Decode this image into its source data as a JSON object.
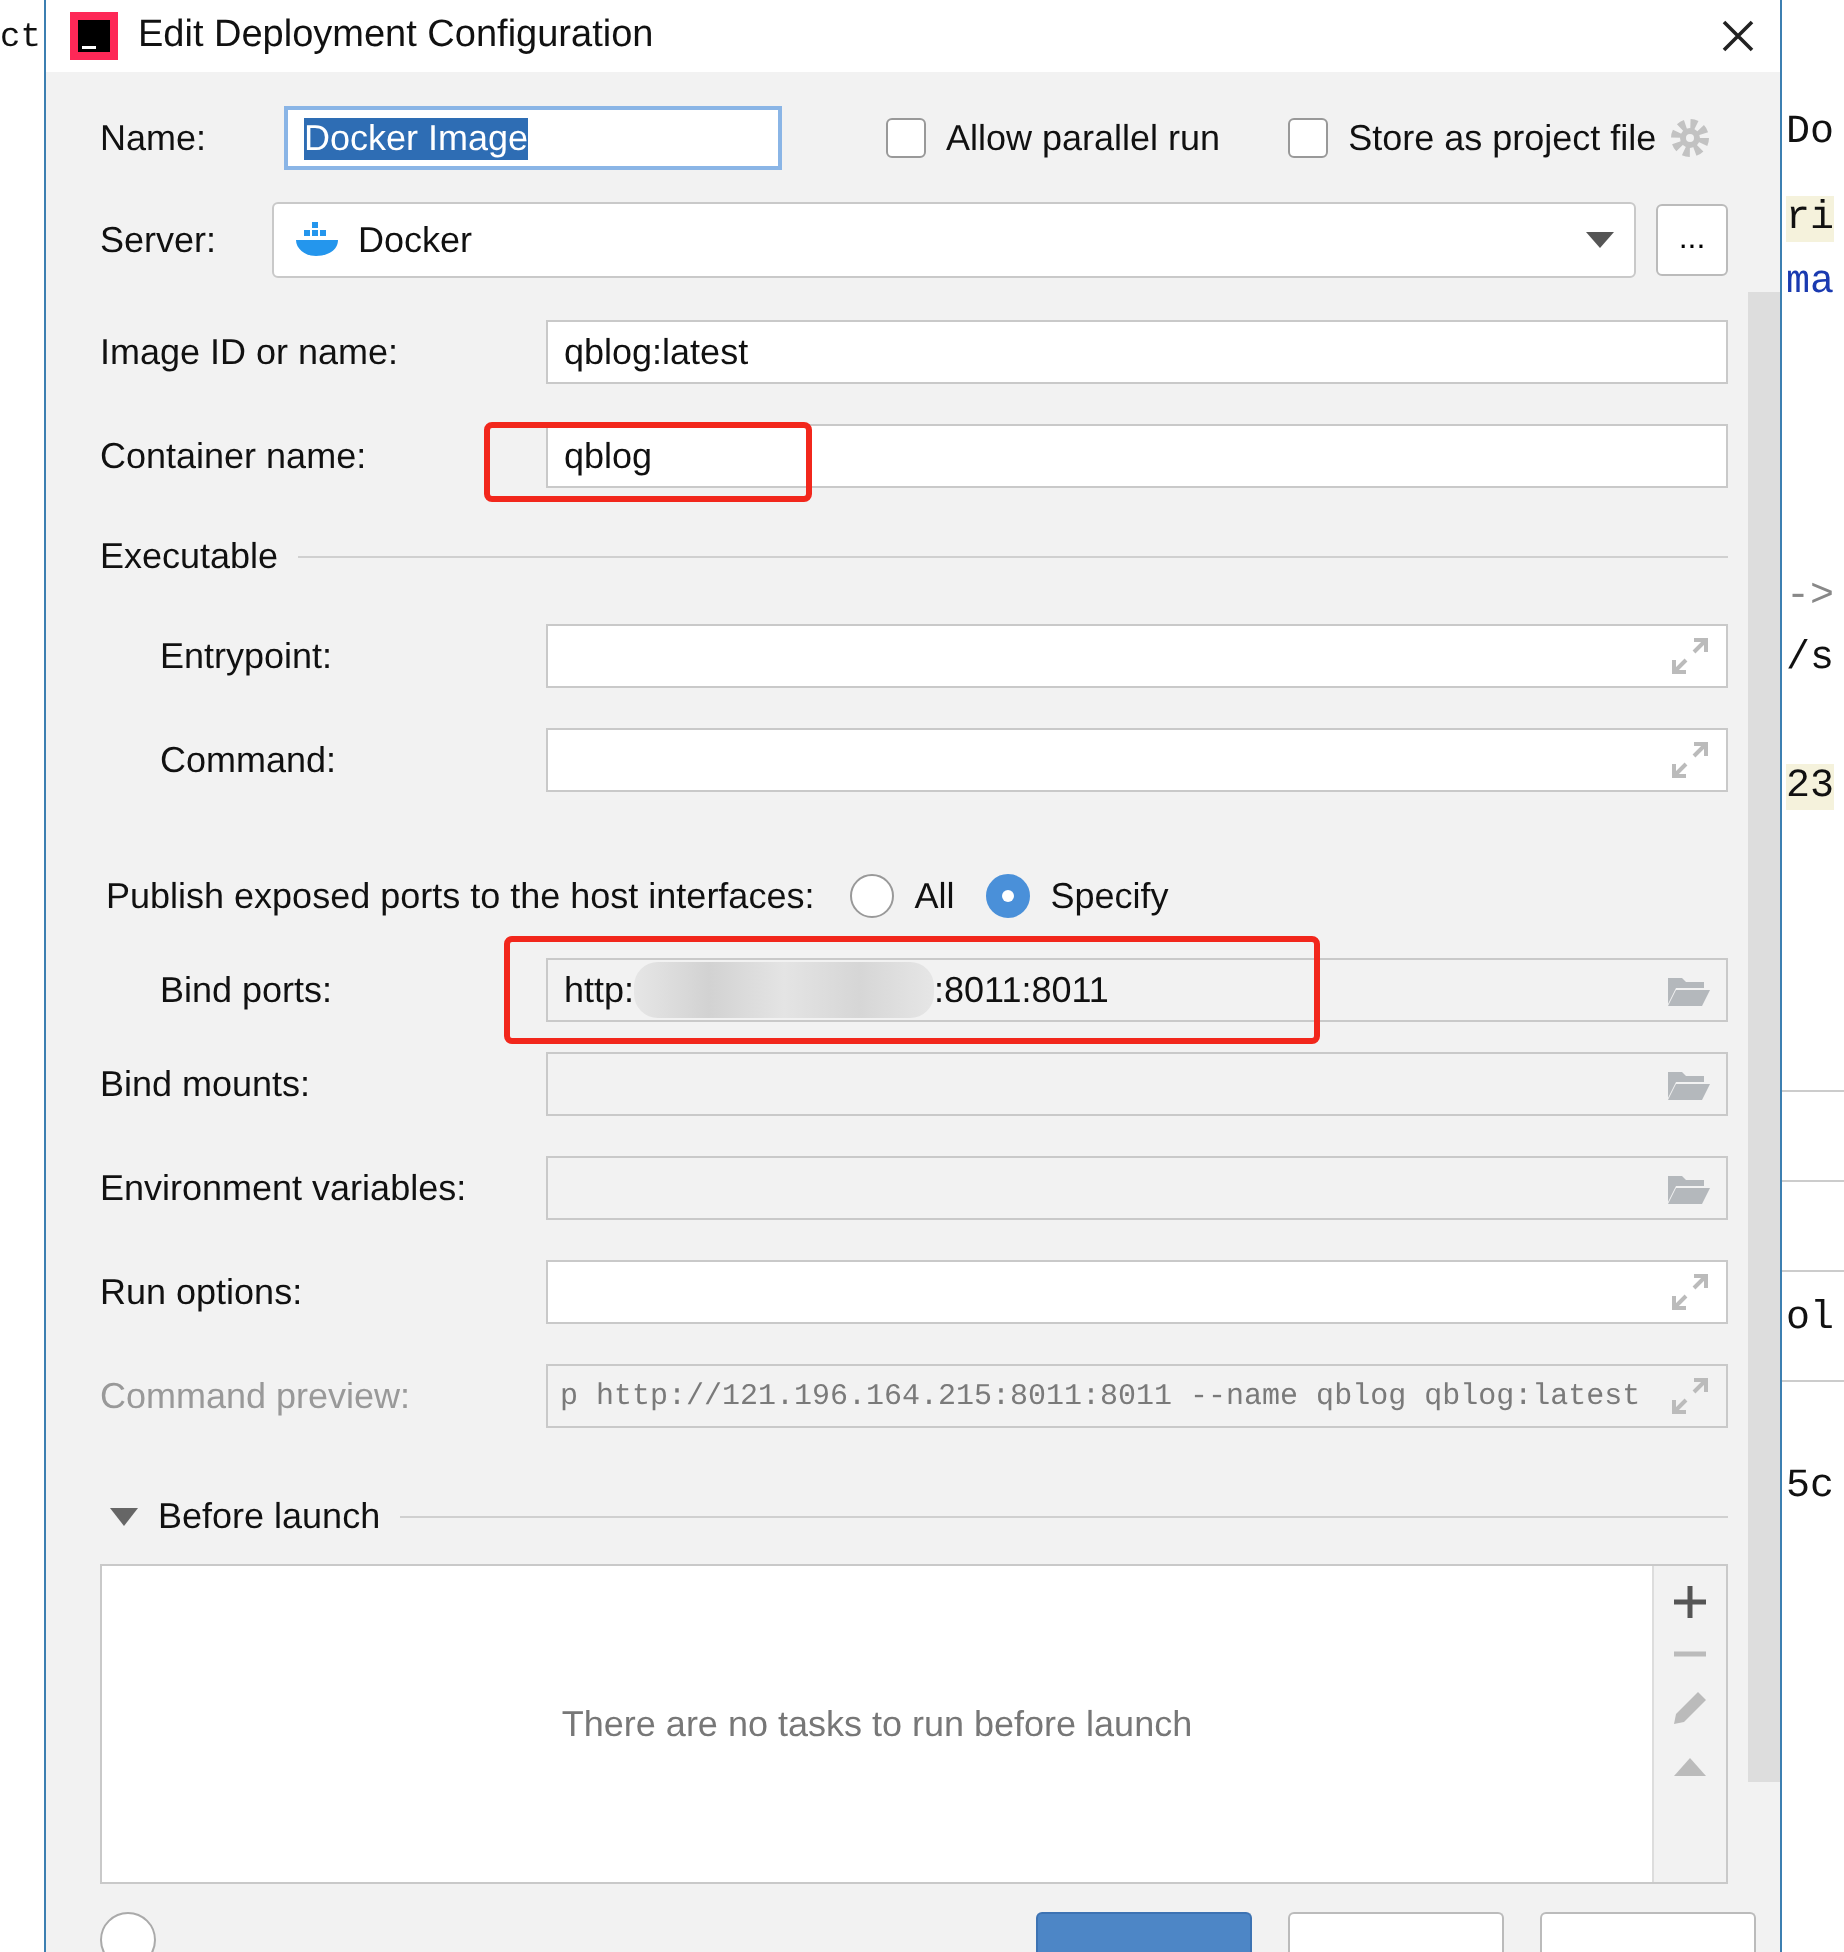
{
  "background": {
    "left_fragments": [
      "ct"
    ],
    "right_fragments": [
      {
        "text": "Do",
        "kind": "plain"
      },
      {
        "text": "ri",
        "kind": "highlight"
      },
      {
        "text": "ma",
        "kind": "keyword"
      },
      {
        "text": "->",
        "kind": "comment"
      },
      {
        "text": "/s",
        "kind": "plain"
      },
      {
        "text": "23",
        "kind": "highlight"
      },
      {
        "text": "ol",
        "kind": "plain"
      },
      {
        "text": "5c",
        "kind": "plain"
      }
    ]
  },
  "window": {
    "title": "Edit Deployment Configuration"
  },
  "name": {
    "label": "Name:",
    "value": "Docker Image"
  },
  "options": [
    {
      "label": "Allow parallel run",
      "checked": false
    },
    {
      "label": "Store as project file",
      "checked": false
    }
  ],
  "server": {
    "label": "Server:",
    "value": "Docker",
    "more": "..."
  },
  "fields": [
    {
      "label": "Image ID or name:",
      "value": "qblog:latest",
      "highlighted": false
    },
    {
      "label": "Container name:",
      "value": "qblog",
      "highlighted": true
    }
  ],
  "executable": {
    "title": "Executable",
    "fields": [
      {
        "label": "Entrypoint:"
      },
      {
        "label": "Command:"
      }
    ]
  },
  "publish": {
    "label": "Publish exposed ports to the host interfaces:",
    "choices": [
      {
        "label": "All",
        "selected": false
      },
      {
        "label": "Specify",
        "selected": true
      }
    ]
  },
  "bind_ports": {
    "label": "Bind ports:",
    "value_start": "http:",
    "value_end": ":8011:8011",
    "highlighted": true
  },
  "lower_fields": [
    {
      "label": "Bind mounts:",
      "kind": "folder"
    },
    {
      "label": "Environment variables:",
      "kind": "folder"
    },
    {
      "label": "Run options:",
      "kind": "expand"
    }
  ],
  "preview": {
    "label": "Command preview:",
    "value": "p http://121.196.164.215:8011:8011 --name qblog qblog:latest"
  },
  "before_launch": {
    "title": "Before launch",
    "expanded": true,
    "empty_text": "There are no tasks to run before launch"
  }
}
